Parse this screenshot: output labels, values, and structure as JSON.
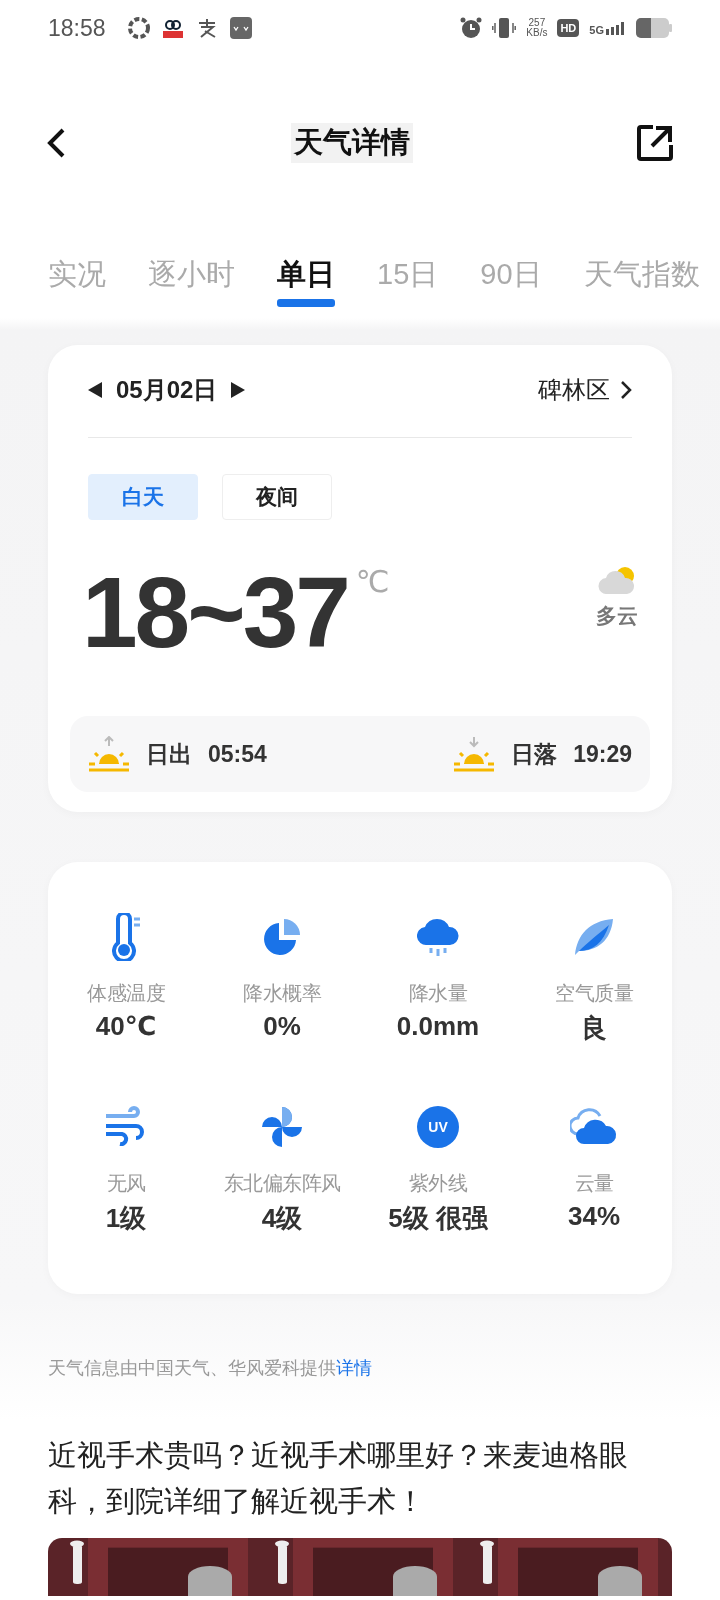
{
  "status_bar": {
    "time": "18:58",
    "speed_value": "257",
    "speed_unit": "KB/s",
    "hd": "HD",
    "network": "5G"
  },
  "header": {
    "title": "天气详情"
  },
  "tabs": [
    {
      "label": "实况",
      "selected": false
    },
    {
      "label": "逐小时",
      "selected": false
    },
    {
      "label": "单日",
      "selected": true
    },
    {
      "label": "15日",
      "selected": false
    },
    {
      "label": "90日",
      "selected": false
    },
    {
      "label": "天气指数",
      "selected": false
    }
  ],
  "day_card": {
    "date": "05月02日",
    "location": "碑林区",
    "periods": [
      {
        "label": "白天",
        "selected": true
      },
      {
        "label": "夜间",
        "selected": false
      }
    ],
    "temperature": "18~37",
    "unit": "℃",
    "condition": "多云",
    "sun": [
      {
        "kind": "sunrise",
        "label": "日出",
        "time": "05:54"
      },
      {
        "kind": "sunset",
        "label": "日落",
        "time": "19:29"
      }
    ]
  },
  "details": [
    {
      "kind": "thermometer",
      "label": "体感温度",
      "value": "40℃"
    },
    {
      "kind": "pie",
      "label": "降水概率",
      "value": "0%"
    },
    {
      "kind": "rain",
      "label": "降水量",
      "value": "0.0mm"
    },
    {
      "kind": "leaf",
      "label": "空气质量",
      "value": "良"
    },
    {
      "kind": "wind",
      "label": "无风",
      "value": "1级"
    },
    {
      "kind": "pinwheel",
      "label": "东北偏东阵风",
      "value": "4级"
    },
    {
      "kind": "uv",
      "badge": "UV",
      "label": "紫外线",
      "value": "5级 很强"
    },
    {
      "kind": "cloud",
      "label": "云量",
      "value": "34%"
    }
  ],
  "source": {
    "text": "天气信息由中国天气、华风爱科提供",
    "link": "详情"
  },
  "ad": {
    "title": "近视手术贵吗？近视手术哪里好？来麦迪格眼科，到院详细了解近视手术！"
  }
}
